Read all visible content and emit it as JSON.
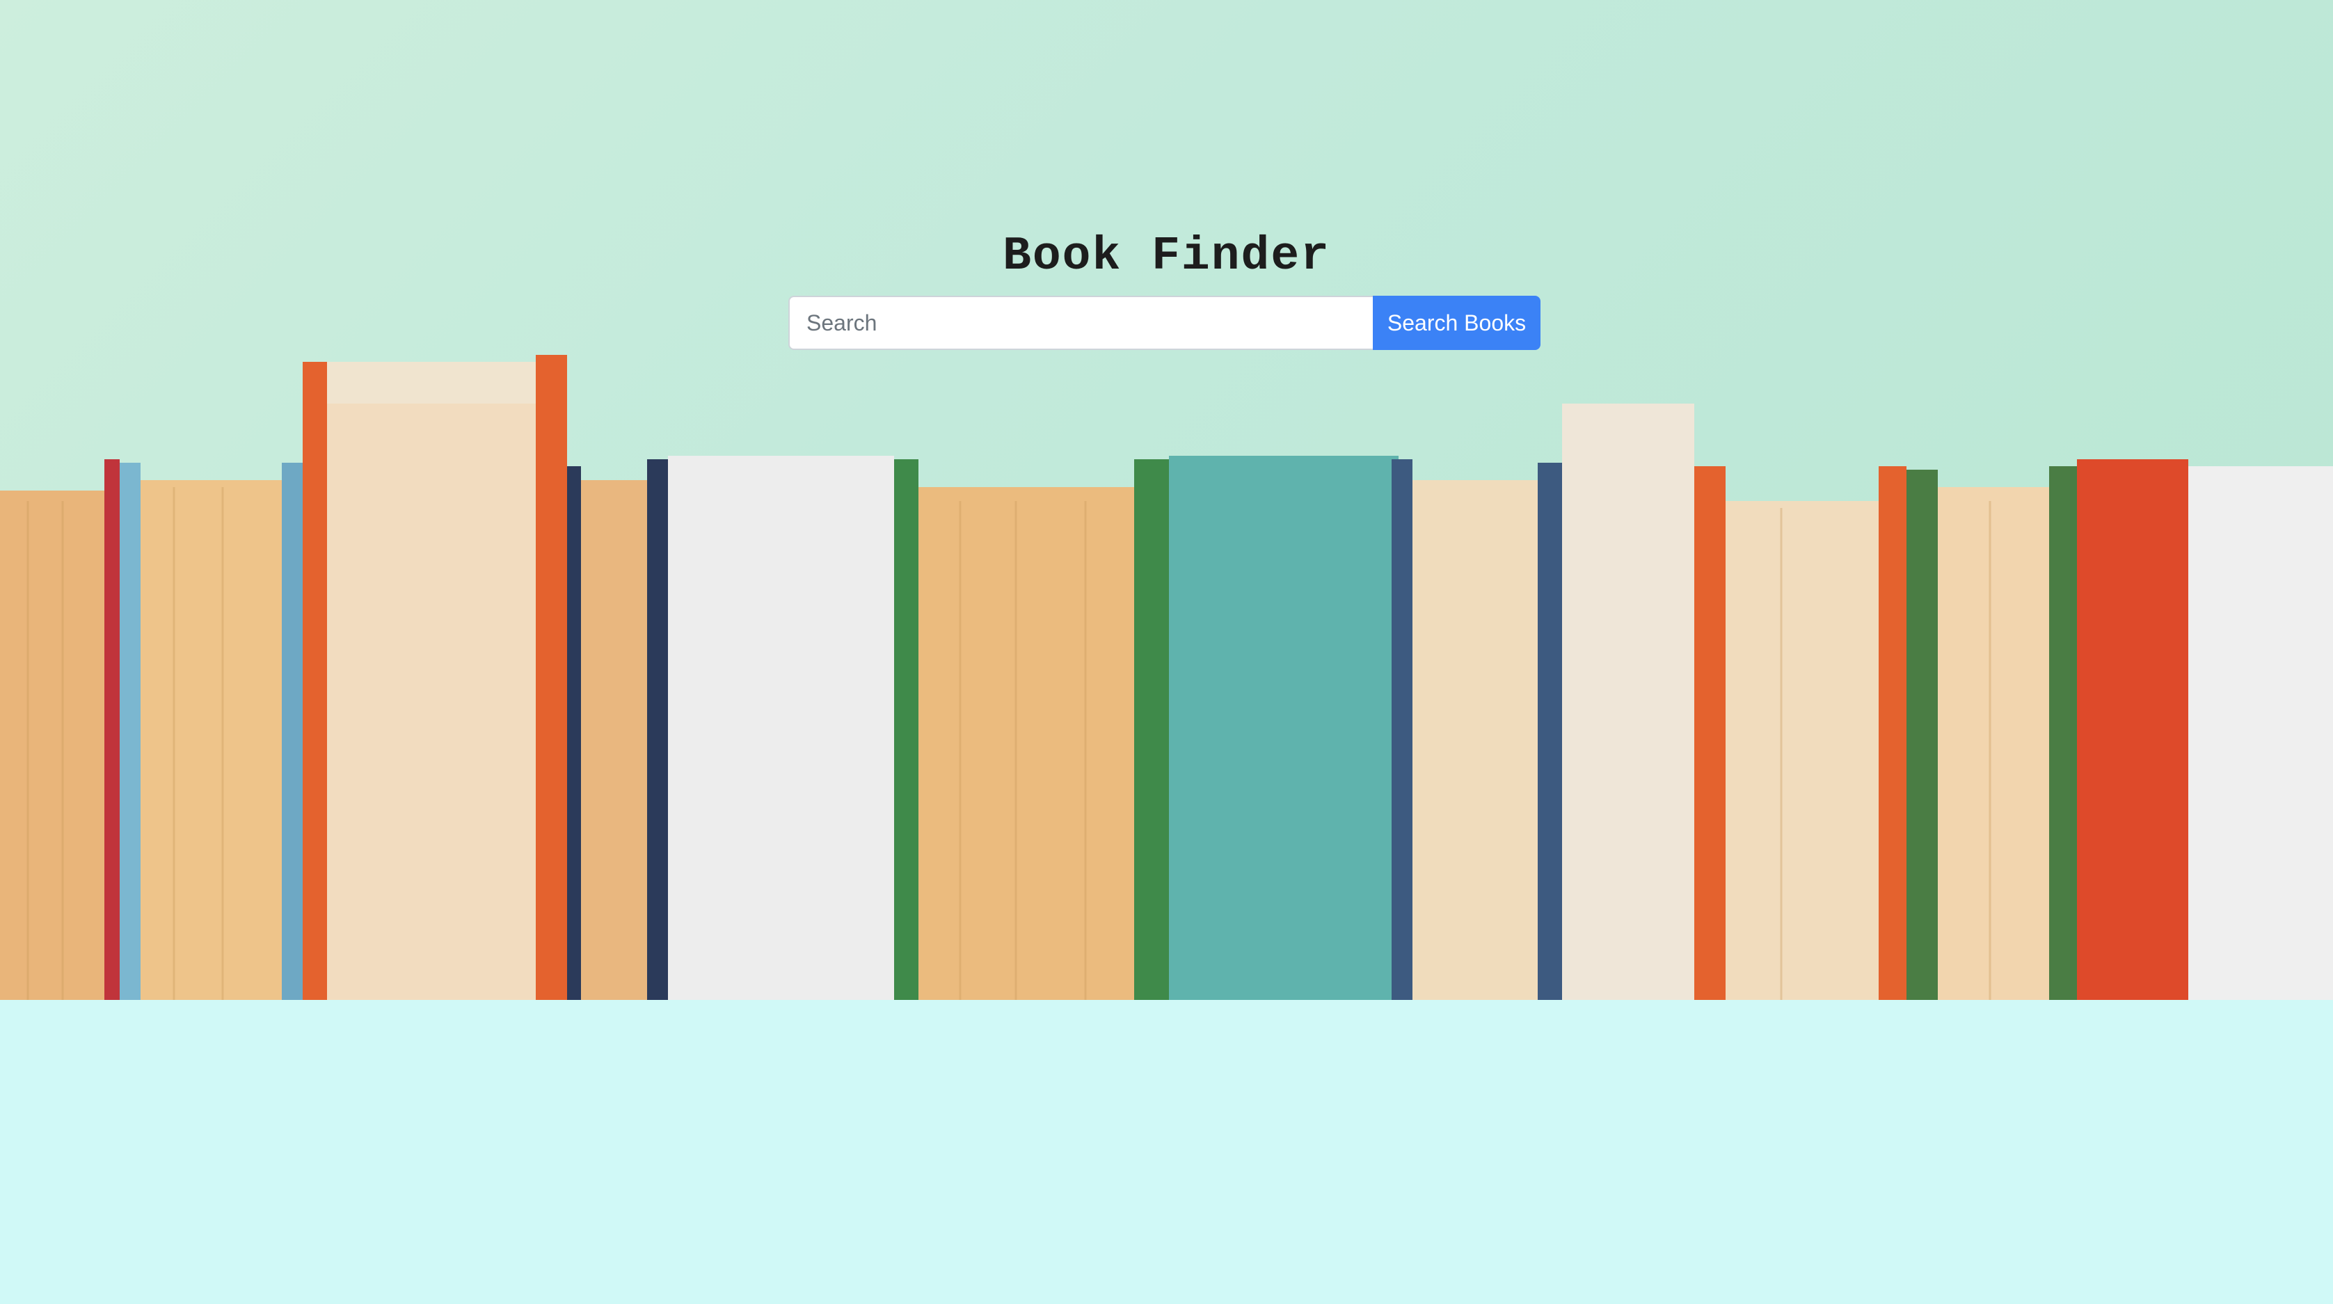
{
  "page": {
    "title": "Book Finder",
    "background_color": "#d0f9f7",
    "accent_color": "#3b82f6"
  },
  "search": {
    "placeholder": "Search",
    "value": "",
    "button_label": "Search Books"
  },
  "hero": {
    "image": "bookshelf-photo"
  }
}
